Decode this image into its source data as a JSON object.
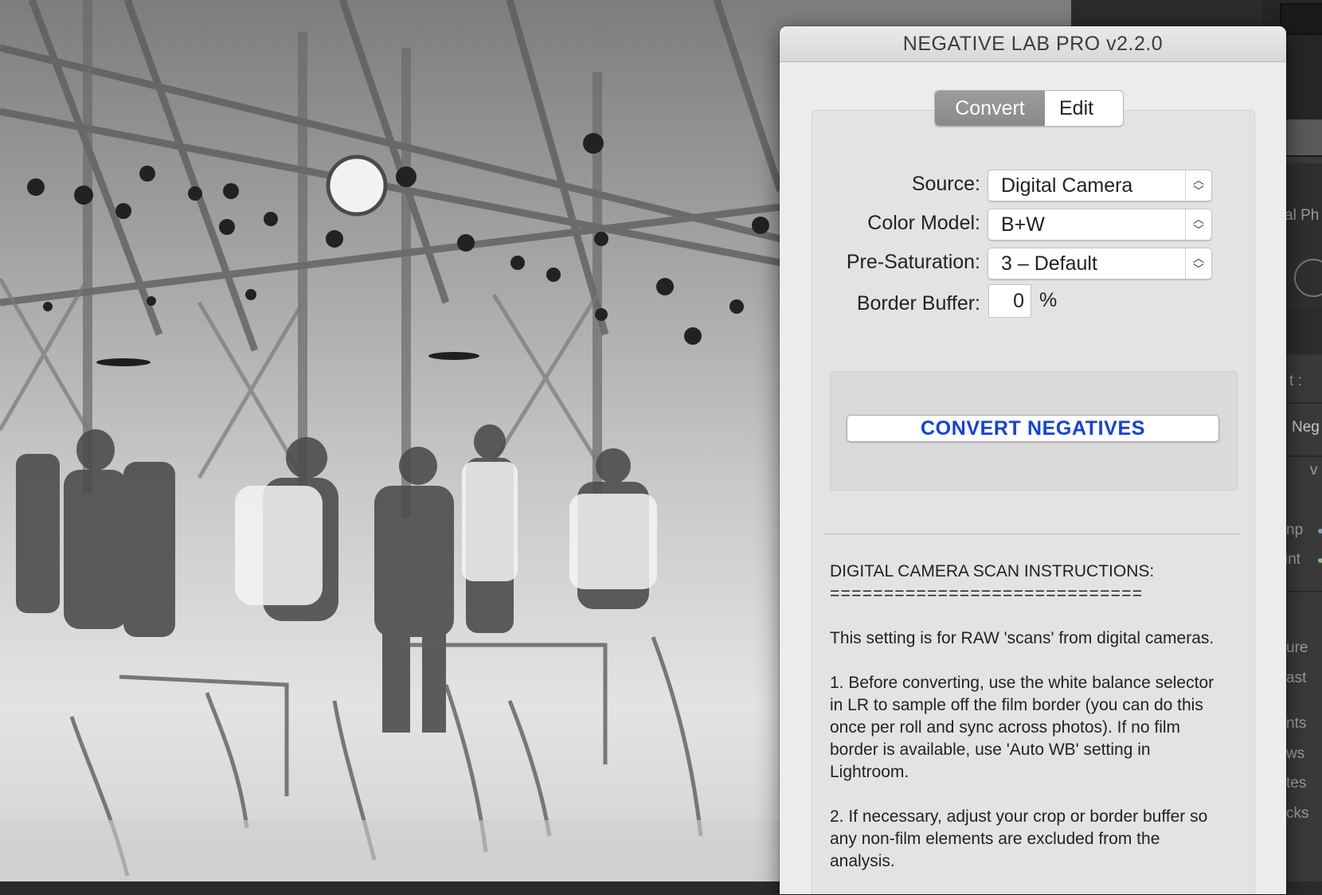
{
  "window": {
    "title": "NEGATIVE LAB PRO v2.2.0"
  },
  "tabs": {
    "convert": "Convert",
    "edit": "Edit"
  },
  "form": {
    "source_label": "Source:",
    "source_value": "Digital Camera",
    "color_model_label": "Color Model:",
    "color_model_value": "B+W",
    "pre_saturation_label": "Pre-Saturation:",
    "pre_saturation_value": "3 – Default",
    "border_buffer_label": "Border Buffer:",
    "border_buffer_value": "0",
    "border_buffer_unit": "%"
  },
  "convert_button": "CONVERT NEGATIVES",
  "instructions": {
    "heading": "DIGITAL CAMERA SCAN INSTRUCTIONS:",
    "rule": "=============================",
    "p1": "This setting is for RAW 'scans' from digital cameras.",
    "p2": "1. Before converting, use the white balance selector in LR to sample off the film border (you can do this once per roll and sync across photos). If no film border is available, use 'Auto WB' setting in Lightroom.",
    "p3": "2. If necessary, adjust your crop or border buffer so any non-film elements are excluded from the analysis."
  },
  "lr_panel": {
    "labels": [
      "al Ph",
      "t :",
      "Neg",
      "v",
      "np",
      "int",
      "ure",
      "ast",
      "nts",
      "ws",
      "tes",
      "cks"
    ]
  },
  "icons": {
    "stepper": "up-down-chevron-icon"
  }
}
